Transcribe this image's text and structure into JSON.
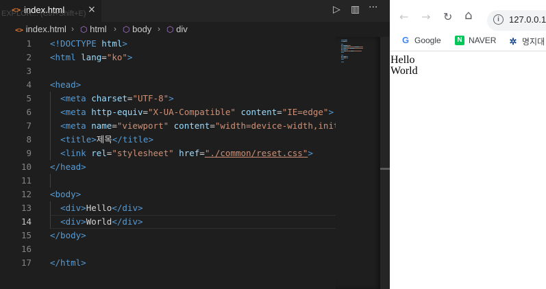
{
  "editor": {
    "tab": {
      "icon": "html-file-icon",
      "label": "index.html",
      "close": "×"
    },
    "ghost_text": "EXPLOR... (Ctrl+Shift+E)",
    "toolbar": {
      "run_icon": "▷",
      "split_icon": "▥",
      "more_icon": "···"
    },
    "breadcrumb": [
      "index.html",
      "html",
      "body",
      "div"
    ],
    "line_numbers": [
      "1",
      "2",
      "3",
      "4",
      "5",
      "6",
      "7",
      "8",
      "9",
      "10",
      "11",
      "12",
      "13",
      "14",
      "15",
      "16",
      "17"
    ],
    "active_line": "14",
    "lines": [
      [
        [
          "tag",
          "<!DOCTYPE "
        ],
        [
          "attr",
          "html"
        ],
        [
          "tag",
          ">"
        ]
      ],
      [
        [
          "tag",
          "<html "
        ],
        [
          "attr",
          "lang"
        ],
        [
          "txt",
          "="
        ],
        [
          "str",
          "\"ko\""
        ],
        [
          "tag",
          ">"
        ]
      ],
      [],
      [
        [
          "tag",
          "<head>"
        ]
      ],
      [
        [
          "txt",
          "  "
        ],
        [
          "tag",
          "<meta "
        ],
        [
          "attr",
          "charset"
        ],
        [
          "txt",
          "="
        ],
        [
          "str",
          "\"UTF-8\""
        ],
        [
          "tag",
          ">"
        ]
      ],
      [
        [
          "txt",
          "  "
        ],
        [
          "tag",
          "<meta "
        ],
        [
          "attr",
          "http-equiv"
        ],
        [
          "txt",
          "="
        ],
        [
          "str",
          "\"X-UA-Compatible\""
        ],
        [
          "txt",
          " "
        ],
        [
          "attr",
          "content"
        ],
        [
          "txt",
          "="
        ],
        [
          "str",
          "\"IE=edge\""
        ],
        [
          "tag",
          ">"
        ]
      ],
      [
        [
          "txt",
          "  "
        ],
        [
          "tag",
          "<meta "
        ],
        [
          "attr",
          "name"
        ],
        [
          "txt",
          "="
        ],
        [
          "str",
          "\"viewport\""
        ],
        [
          "txt",
          " "
        ],
        [
          "attr",
          "content"
        ],
        [
          "txt",
          "="
        ],
        [
          "str",
          "\"width=device-width,init"
        ]
      ],
      [
        [
          "txt",
          "  "
        ],
        [
          "tag",
          "<title>"
        ],
        [
          "txt",
          "제목"
        ],
        [
          "tag",
          "</title>"
        ]
      ],
      [
        [
          "txt",
          "  "
        ],
        [
          "tag",
          "<link "
        ],
        [
          "attr",
          "rel"
        ],
        [
          "txt",
          "="
        ],
        [
          "str",
          "\"stylesheet\""
        ],
        [
          "txt",
          " "
        ],
        [
          "attr",
          "href"
        ],
        [
          "txt",
          "="
        ],
        [
          "str",
          "\"./common/reset.css\""
        ],
        [
          "tag",
          ">"
        ]
      ],
      [
        [
          "tag",
          "</head>"
        ]
      ],
      [],
      [
        [
          "tag",
          "<body>"
        ]
      ],
      [
        [
          "txt",
          "  "
        ],
        [
          "tag",
          "<div>"
        ],
        [
          "txt",
          "Hello"
        ],
        [
          "tag",
          "</div>"
        ]
      ],
      [
        [
          "txt",
          "  "
        ],
        [
          "tag",
          "<div>"
        ],
        [
          "txt",
          "World"
        ],
        [
          "tag",
          "</div>"
        ]
      ],
      [
        [
          "tag",
          "</body>"
        ]
      ],
      [],
      [
        [
          "tag",
          "</html>"
        ]
      ]
    ]
  },
  "browser": {
    "nav": {
      "back": "←",
      "forward": "→",
      "reload": "↻",
      "home": "⌂"
    },
    "url": "127.0.0.1",
    "info_icon": "i",
    "bookmarks": [
      {
        "icon": "google-icon",
        "glyph": "G",
        "label": "Google"
      },
      {
        "icon": "naver-icon",
        "glyph": "N",
        "label": "NAVER"
      },
      {
        "icon": "myongji-icon",
        "glyph": "✲",
        "label": "명지대"
      }
    ],
    "page_lines": [
      "Hello",
      "World"
    ]
  },
  "colors": {
    "tag": "#569cd6",
    "attribute": "#9cdcfe",
    "string": "#ce9178",
    "text": "#d4d4d4",
    "editor_bg": "#1e1e1e"
  }
}
